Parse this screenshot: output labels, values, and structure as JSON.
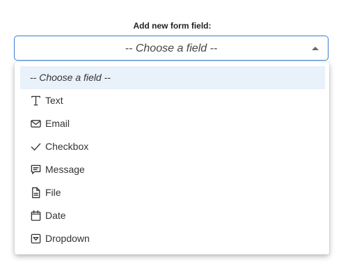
{
  "form": {
    "label": "Add new form field:",
    "select_value": "-- Choose a field --"
  },
  "dropdown": {
    "placeholder": "-- Choose a field --",
    "options": [
      {
        "label": "Text",
        "icon": "text-icon"
      },
      {
        "label": "Email",
        "icon": "envelope-icon"
      },
      {
        "label": "Checkbox",
        "icon": "checkmark-icon"
      },
      {
        "label": "Message",
        "icon": "message-icon"
      },
      {
        "label": "File",
        "icon": "file-icon"
      },
      {
        "label": "Date",
        "icon": "calendar-icon"
      },
      {
        "label": "Dropdown",
        "icon": "dropdown-icon"
      }
    ]
  },
  "colors": {
    "select_border": "#3a7bd5",
    "highlight": "#e9f1fb"
  }
}
